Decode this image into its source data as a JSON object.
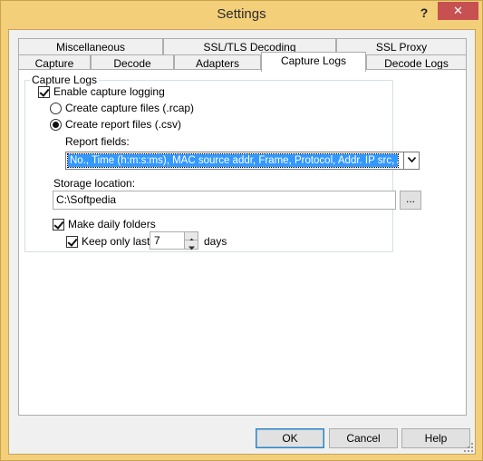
{
  "window": {
    "title": "Settings",
    "help_glyph": "?",
    "close_glyph": "✕"
  },
  "tabs_row1": [
    {
      "label": "Miscellaneous"
    },
    {
      "label": "SSL/TLS Decoding"
    },
    {
      "label": "SSL Proxy"
    }
  ],
  "tabs_row2": [
    {
      "label": "Capture"
    },
    {
      "label": "Decode"
    },
    {
      "label": "Adapters"
    },
    {
      "label": "Capture Logs",
      "active": true
    },
    {
      "label": "Decode Logs"
    }
  ],
  "capture_logs": {
    "group_title": "Capture Logs",
    "enable_logging": {
      "label": "Enable capture logging",
      "checked": true
    },
    "create_capture_files": {
      "label": "Create capture files (.rcap)",
      "selected": false
    },
    "create_report_files": {
      "label": "Create report files (.csv)",
      "selected": true
    },
    "report_fields_label": "Report fields:",
    "report_fields_value": "No., Time (h:m:s:ms), MAC source addr, Frame, Protocol, Addr. IP src, Addr...",
    "storage_label": "Storage location:",
    "storage_value": "C:\\Softpedia",
    "browse_label": "...",
    "daily_folders": {
      "label": "Make daily folders",
      "checked": true
    },
    "keep_only_last": {
      "label": "Keep only last",
      "checked": true,
      "value": "7",
      "unit": "days"
    }
  },
  "buttons": {
    "ok": "OK",
    "cancel": "Cancel",
    "help": "Help"
  }
}
